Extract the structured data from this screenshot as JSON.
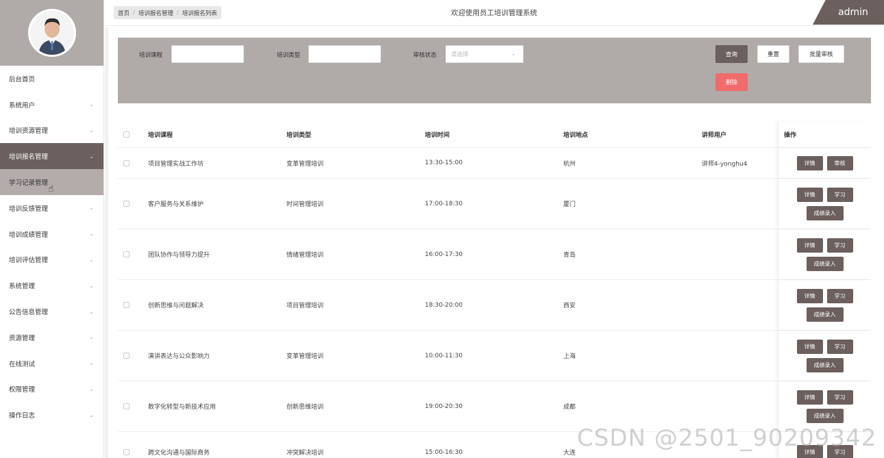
{
  "sidebar": {
    "items": [
      {
        "label": "后台首页",
        "chevron": false,
        "state": ""
      },
      {
        "label": "系统用户",
        "chevron": true,
        "state": ""
      },
      {
        "label": "培训资源管理",
        "chevron": true,
        "state": ""
      },
      {
        "label": "培训报名管理",
        "chevron": true,
        "state": "active"
      },
      {
        "label": "学习记录管理",
        "chevron": true,
        "state": "hover"
      },
      {
        "label": "培训反馈管理",
        "chevron": true,
        "state": ""
      },
      {
        "label": "培训成绩管理",
        "chevron": true,
        "state": ""
      },
      {
        "label": "培训评估管理",
        "chevron": true,
        "state": ""
      },
      {
        "label": "系统管理",
        "chevron": true,
        "state": ""
      },
      {
        "label": "公告信息管理",
        "chevron": true,
        "state": ""
      },
      {
        "label": "资源管理",
        "chevron": true,
        "state": ""
      },
      {
        "label": "在线测试",
        "chevron": true,
        "state": ""
      },
      {
        "label": "权限管理",
        "chevron": true,
        "state": ""
      },
      {
        "label": "操作日志",
        "chevron": true,
        "state": ""
      }
    ]
  },
  "header": {
    "breadcrumb": [
      "首页",
      "培训报名管理",
      "培训报名列表"
    ],
    "welcome": "欢迎使用员工培训管理系统",
    "user": "admin"
  },
  "search": {
    "course_label": "培训课程",
    "type_label": "培训类型",
    "status_label": "审核状态",
    "status_placeholder": "请选择",
    "query_btn": "查询",
    "reset_btn": "重置",
    "batch_btn": "批量审核",
    "delete_btn": "删除"
  },
  "table": {
    "headers": {
      "course": "培训课程",
      "type": "培训类型",
      "time": "培训时间",
      "place": "培训地点",
      "teacher": "讲师用户",
      "ops": "操作"
    },
    "rows": [
      {
        "course": "项目管理实战工作坊",
        "type": "变革管理培训",
        "time": "13:30-15:00",
        "place": "杭州",
        "teacher": "讲师4-yonghu4",
        "ops": [
          [
            "详情",
            "审核"
          ]
        ]
      },
      {
        "course": "客户服务与关系维护",
        "type": "时间管理培训",
        "time": "17:00-18:30",
        "place": "厦门",
        "teacher": "",
        "ops": [
          [
            "详情",
            "学习"
          ],
          [
            "成绩录入"
          ]
        ]
      },
      {
        "course": "团队协作与领导力提升",
        "type": "情绪管理培训",
        "time": "16:00-17:30",
        "place": "青岛",
        "teacher": "",
        "ops": [
          [
            "详情",
            "学习"
          ],
          [
            "成绩录入"
          ]
        ]
      },
      {
        "course": "创新思维与问题解决",
        "type": "项目管理培训",
        "time": "18:30-20:00",
        "place": "西安",
        "teacher": "",
        "ops": [
          [
            "详情",
            "学习"
          ],
          [
            "成绩录入"
          ]
        ]
      },
      {
        "course": "演讲表达与公众影响力",
        "type": "变革管理培训",
        "time": "10:00-11:30",
        "place": "上海",
        "teacher": "",
        "ops": [
          [
            "详情",
            "学习"
          ],
          [
            "成绩录入"
          ]
        ]
      },
      {
        "course": "数字化转型与新技术应用",
        "type": "创新思维培训",
        "time": "19:00-20:30",
        "place": "成都",
        "teacher": "",
        "ops": [
          [
            "详情",
            "学习"
          ],
          [
            "成绩录入"
          ]
        ]
      },
      {
        "course": "跨文化沟通与国际商务",
        "type": "冲突解决培训",
        "time": "15:00-16:30",
        "place": "大连",
        "teacher": "",
        "ops": [
          [
            "详情",
            "学习"
          ]
        ]
      }
    ]
  },
  "watermark": "CSDN @2501_90209342",
  "colors": {
    "accent": "#6b605d",
    "panel": "#b0aaa8",
    "danger": "#f06b6b"
  }
}
